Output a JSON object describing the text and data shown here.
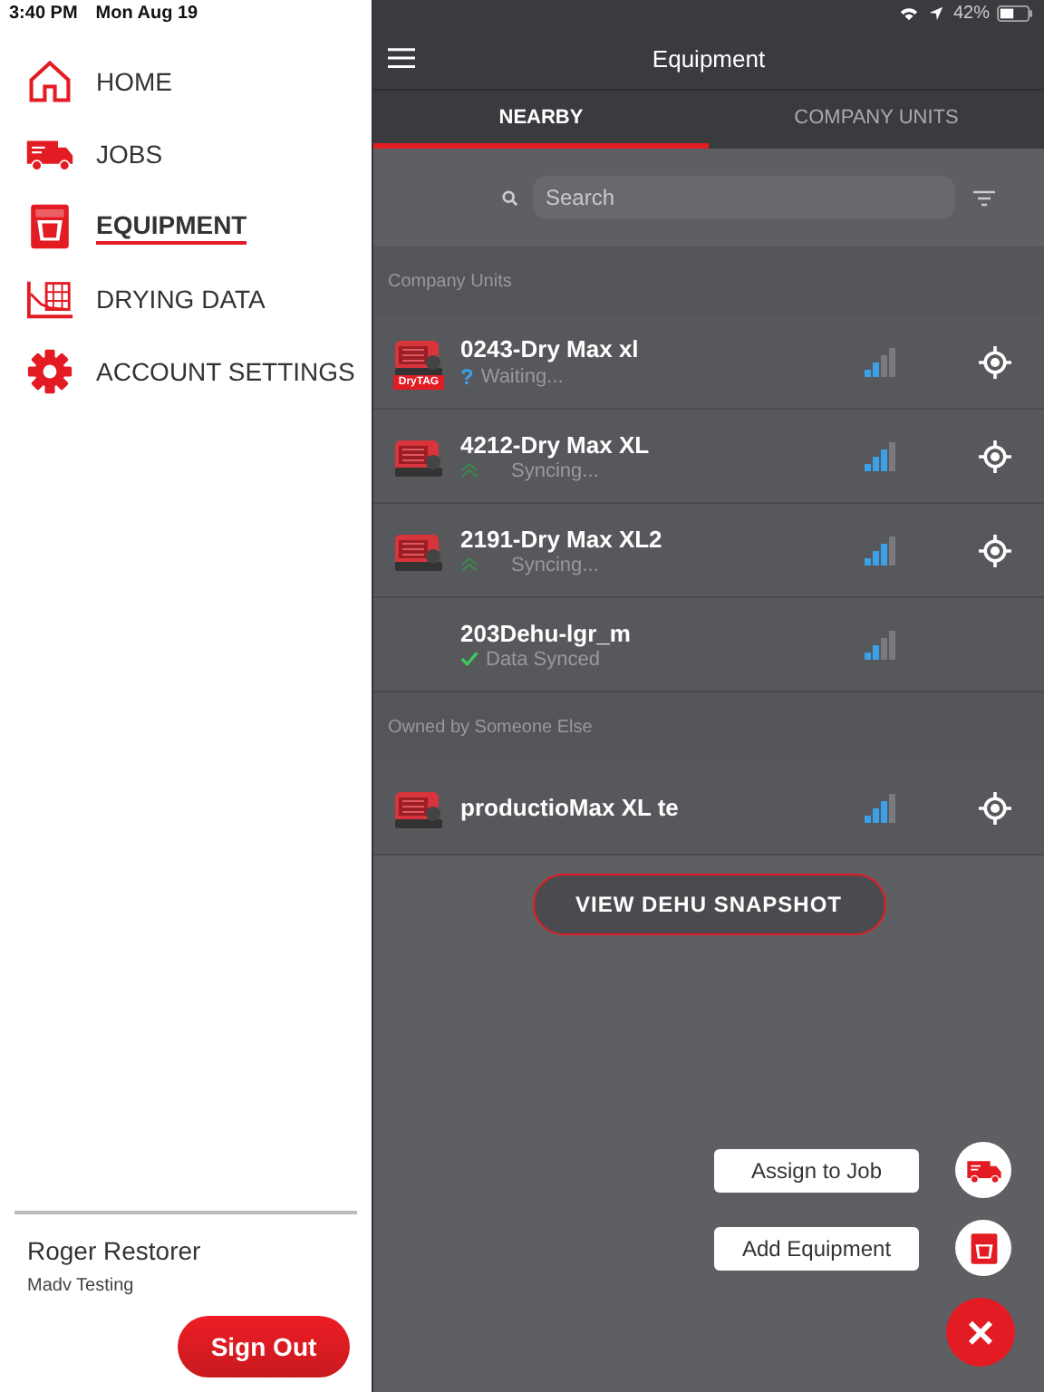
{
  "status_bar": {
    "time": "3:40 PM",
    "date": "Mon Aug 19",
    "battery": "42%"
  },
  "sidebar": {
    "items": [
      {
        "label": "HOME",
        "kind": "home",
        "selected": false
      },
      {
        "label": "JOBS",
        "kind": "jobs",
        "selected": false
      },
      {
        "label": "EQUIPMENT",
        "kind": "equipment",
        "selected": true
      },
      {
        "label": "DRYING DATA",
        "kind": "drying",
        "selected": false
      },
      {
        "label": "ACCOUNT SETTINGS",
        "kind": "settings",
        "selected": false
      }
    ],
    "user": {
      "name": "Roger Restorer",
      "company": "Madv Testing"
    },
    "sign_out": "Sign Out"
  },
  "header": {
    "title": "Equipment"
  },
  "tabs": [
    {
      "label": "NEARBY",
      "selected": true
    },
    {
      "label": "COMPANY UNITS",
      "selected": false
    }
  ],
  "search": {
    "placeholder": "Search"
  },
  "sections": [
    {
      "title": "Company Units",
      "units": [
        {
          "name": "0243-Dry Max xl",
          "has_picture": true,
          "tag": "DryTAG",
          "status": {
            "kind": "waiting",
            "mark": "?",
            "text": "Waiting..."
          },
          "signal": {
            "kind": "weak"
          },
          "locate": true
        },
        {
          "name": "4212-Dry Max XL",
          "has_picture": true,
          "status": {
            "kind": "syncing",
            "text": "Syncing..."
          },
          "signal": {
            "kind": "good"
          },
          "locate": true
        },
        {
          "name": "2191-Dry Max XL2",
          "has_picture": true,
          "status": {
            "kind": "syncing",
            "text": "Syncing..."
          },
          "signal": {
            "kind": "good"
          },
          "locate": true
        },
        {
          "name": "203Dehu-lgr_m",
          "has_picture": false,
          "status": {
            "kind": "synced",
            "text": "Data Synced"
          },
          "signal": {
            "kind": "weak"
          },
          "locate": false
        }
      ]
    },
    {
      "title": "Owned by Someone Else",
      "units": [
        {
          "name": "productioMax XL te",
          "has_picture": true,
          "signal": {
            "kind": "good"
          },
          "locate": true
        }
      ]
    }
  ],
  "snapshot_button": "VIEW DEHU SNAPSHOT",
  "fab_actions": [
    {
      "label": "Assign to Job",
      "kind": "jobs"
    },
    {
      "label": "Add Equipment",
      "kind": "equipment"
    }
  ],
  "fab_close": "×"
}
